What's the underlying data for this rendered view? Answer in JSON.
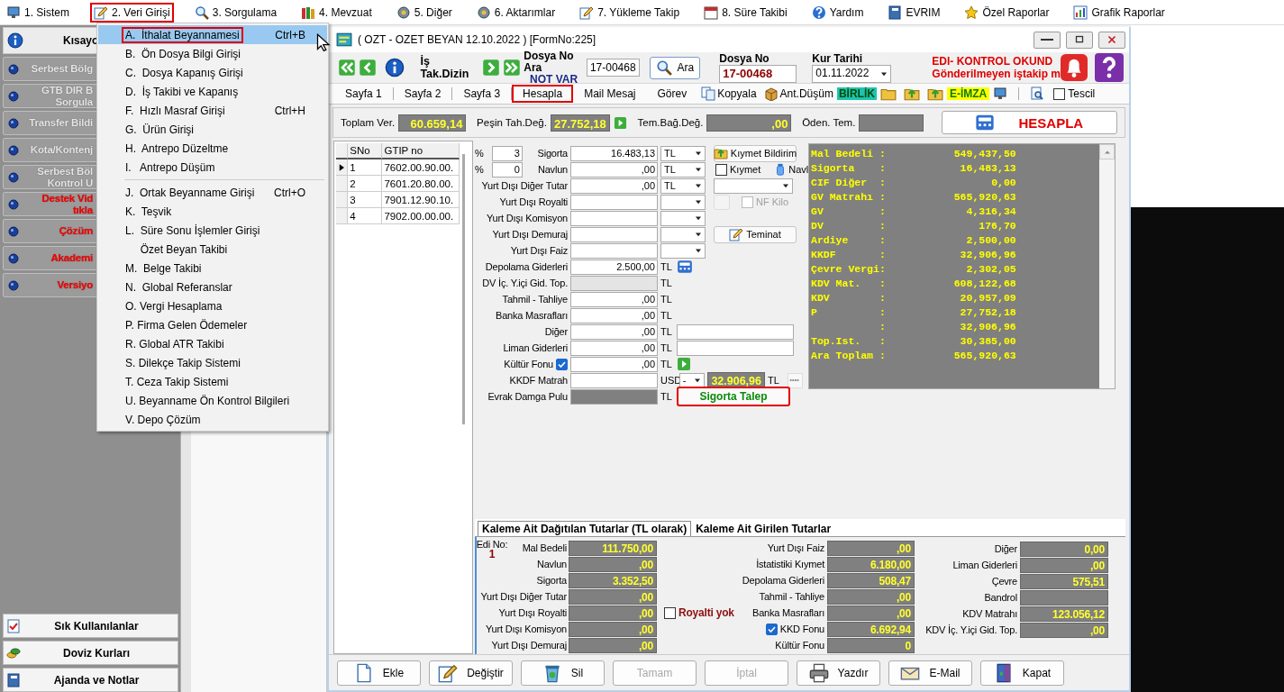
{
  "menu": [
    {
      "label": "1. Sistem",
      "selected": false
    },
    {
      "label": "2. Veri Girişi",
      "selected": true
    },
    {
      "label": "3. Sorgulama",
      "selected": false
    },
    {
      "label": "4. Mevzuat",
      "selected": false
    },
    {
      "label": "5. Diğer",
      "selected": false
    },
    {
      "label": "6. Aktarımlar",
      "selected": false
    },
    {
      "label": "7. Yükleme Takip",
      "selected": false
    },
    {
      "label": "8. Süre Takibi",
      "selected": false
    },
    {
      "label": "Yardım",
      "selected": false
    },
    {
      "label": "EVRIM",
      "selected": false
    },
    {
      "label": "Özel Raporlar",
      "selected": false
    },
    {
      "label": "Grafik Raporlar",
      "selected": false
    }
  ],
  "dropdown": {
    "groups": [
      [
        {
          "label": "A.  İthalat Beyannamesi",
          "shortcut": "Ctrl+B",
          "selected": true
        },
        {
          "label": "B.  Ön Dosya Bilgi Girişi",
          "selected": false
        },
        {
          "label": "C.  Dosya Kapanış Girişi",
          "selected": false
        },
        {
          "label": "D.  İş Takibi ve Kapanış",
          "selected": false
        },
        {
          "label": "F.  Hızlı Masraf Girişi",
          "shortcut": "Ctrl+H",
          "selected": false
        },
        {
          "label": "G.  Ürün Girişi",
          "selected": false
        },
        {
          "label": "H.  Antrepo Düzeltme",
          "selected": false
        },
        {
          "label": "I.   Antrepo Düşüm",
          "selected": false
        }
      ],
      [
        {
          "label": "J.  Ortak Beyanname Girişi",
          "shortcut": "Ctrl+O",
          "selected": false
        },
        {
          "label": "K.  Teşvik",
          "selected": false
        },
        {
          "label": "L.  Süre Sonu İşlemler Girişi",
          "selected": false
        },
        {
          "label": "     Özet Beyan Takibi",
          "selected": false
        },
        {
          "label": "M.  Belge Takibi",
          "selected": false
        },
        {
          "label": "N.  Global Referanslar",
          "selected": false
        },
        {
          "label": "O. Vergi Hesaplama",
          "selected": false
        },
        {
          "label": "P. Firma Gelen Ödemeler",
          "selected": false
        },
        {
          "label": "R. Global ATR Takibi",
          "selected": false
        },
        {
          "label": "S. Dilekçe Takip Sistemi",
          "selected": false
        },
        {
          "label": "T. Ceza Takip Sistemi",
          "selected": false
        },
        {
          "label": "U. Beyanname Ön Kontrol Bilgileri",
          "selected": false
        },
        {
          "label": "V. Depo Çözüm",
          "selected": false
        }
      ]
    ]
  },
  "sidebar": {
    "title": "Kısayo",
    "items": [
      {
        "lines": [
          "Serbest Bölg"
        ],
        "color": "#e6e6e6"
      },
      {
        "lines": [
          "GTB DIR B",
          "Sorgula"
        ],
        "color": "#e6e6e6"
      },
      {
        "lines": [
          "Transfer Bildi"
        ],
        "color": "#e6e6e6"
      },
      {
        "lines": [
          "Kota/Kontenj"
        ],
        "color": "#e6e6e6"
      },
      {
        "lines": [
          "Serbest Böl",
          "Kontrol U"
        ],
        "color": "#e6e6e6"
      },
      {
        "lines": [
          "Destek Vid",
          "tıkla"
        ],
        "color": "#ff0000"
      },
      {
        "lines": [
          "Çözüm"
        ],
        "color": "#ff0000"
      },
      {
        "lines": [
          "Akademi"
        ],
        "color": "#ff0000"
      },
      {
        "lines": [
          "Versiyo"
        ],
        "color": "#ff0000"
      }
    ],
    "bottom": [
      "Sık Kullanılanlar",
      "Doviz Kurları",
      "Ajanda ve Notlar"
    ]
  },
  "window": {
    "title": "( OZT - OZET BEYAN 12.10.2022 ) [FormNo:225]"
  },
  "toolbar": {
    "dizin_label": "İş Tak.Dizin",
    "search_label": "Dosya No Ara",
    "search_note": "NOT VAR",
    "search_value": "17-00468",
    "search_button": "Ara",
    "dosya_label": "Dosya No",
    "dosya_value": "17-00468",
    "kur_label": "Kur Tarihi",
    "kur_value": "01.11.2022",
    "alerts": [
      "EDI- KONTROL OKUND",
      "Gönderilmeyen iştakip m"
    ]
  },
  "tabs": [
    {
      "label": "Sayfa 1",
      "selected": false
    },
    {
      "label": "Sayfa 2",
      "selected": false
    },
    {
      "label": "Sayfa 3",
      "selected": false
    },
    {
      "label": "Hesapla",
      "selected": true
    },
    {
      "label": "Mail Mesaj",
      "selected": false
    },
    {
      "label": "Görev",
      "selected": false
    }
  ],
  "tools": {
    "copy": "Kopyala",
    "drop": "Ant.Düşüm",
    "birlik": "BİRLİK",
    "eimza": "E-İMZA",
    "tescil": {
      "label": "Tescil",
      "checked": false
    }
  },
  "totals": [
    {
      "label": "Toplam Ver.",
      "value": "60.659,14"
    },
    {
      "label": "Peşin Tah.Değ.",
      "value": "27.752,18"
    },
    {
      "label": "Tem.Bağ.Değ.",
      "value": ",00"
    },
    {
      "label": "Öden. Tem."
    }
  ],
  "hesapla_button": "HESAPLA",
  "items": {
    "columns": [
      "SNo",
      "GTIP no"
    ],
    "rows": [
      {
        "cells": [
          "1",
          "7602.00.90.00."
        ],
        "selected": true
      },
      {
        "cells": [
          "2",
          "7601.20.80.00."
        ],
        "selected": false
      },
      {
        "cells": [
          "3",
          "7901.12.90.10."
        ],
        "selected": false
      },
      {
        "cells": [
          "4",
          "7902.00.00.00."
        ],
        "selected": false
      }
    ]
  },
  "form": [
    {
      "kind": "pct",
      "pct_sign": "%",
      "pct": "3",
      "label": "Sigorta",
      "value": "16.483,13",
      "unit": "TL",
      "extras": [
        {
          "kind": "button",
          "label": "Kıymet Bildirim",
          "highlighted": false
        }
      ]
    },
    {
      "kind": "pct",
      "pct_sign": "%",
      "pct": "0",
      "label": "Navlun",
      "value": ",00",
      "unit": "TL",
      "extras": [
        {
          "kind": "check",
          "label": "Kıymet",
          "checked": false,
          "disabled": false
        },
        {
          "kind": "link",
          "label": "Navl"
        }
      ]
    },
    {
      "kind": "select",
      "label": "Yurt Dışı Diğer Tutar",
      "value": ",00",
      "unit": "TL",
      "extras": [
        {
          "kind": "select"
        }
      ]
    },
    {
      "kind": "select",
      "label": "Yurt Dışı Royalti",
      "extras": [
        {
          "kind": "blank"
        },
        {
          "kind": "check",
          "label": "NF Kilo",
          "checked": false,
          "disabled": true
        }
      ]
    },
    {
      "kind": "select",
      "label": "Yurt Dışı Komisyon"
    },
    {
      "kind": "select",
      "label": "Yurt Dışı Demuraj",
      "extras": [
        {
          "kind": "button",
          "label": "Teminat",
          "highlighted": false
        }
      ]
    },
    {
      "kind": "select",
      "label": "Yurt Dışı Faiz"
    },
    {
      "kind": "text",
      "label": "Depolama Giderleri",
      "value": "2.500,00",
      "unit": "TL",
      "extras": [
        {
          "kind": "calc"
        }
      ]
    },
    {
      "kind": "disabled",
      "label": "DV İç. Y.içi Gid. Top.",
      "unit": "TL"
    },
    {
      "kind": "text",
      "label": "Tahmil - Tahliye",
      "value": ",00",
      "unit": "TL"
    },
    {
      "kind": "text",
      "label": "Banka Masrafları",
      "value": ",00",
      "unit": "TL"
    },
    {
      "kind": "text",
      "label": "Diğer",
      "value": ",00",
      "unit": "TL",
      "extras": [
        {
          "kind": "field"
        }
      ]
    },
    {
      "kind": "text",
      "label": "Liman Giderleri",
      "value": ",00",
      "unit": "TL",
      "extras": [
        {
          "kind": "field"
        }
      ]
    },
    {
      "kind": "check",
      "label": "Kültür Fonu",
      "checked": true,
      "value": ",00",
      "unit": "TL",
      "extras": [
        {
          "kind": "go"
        }
      ]
    },
    {
      "kind": "text",
      "label": "KKDF Matrah",
      "unit": "USD",
      "extras": [
        {
          "kind": "select",
          "value": "-"
        },
        {
          "kind": "amount",
          "value": "32.906,96"
        },
        {
          "kind": "unit",
          "label": "TL"
        },
        {
          "kind": "dots"
        }
      ]
    },
    {
      "kind": "dark",
      "label": "Evrak Damga Pulu",
      "unit": "TL",
      "extras": [
        {
          "kind": "button",
          "label": "Sigorta Talep",
          "highlighted": true
        }
      ]
    }
  ],
  "summary": [
    {
      "label": "Mal Bedeli :",
      "value": "549,437,50"
    },
    {
      "label": "Sigorta    :",
      "value": "16,483,13"
    },
    {
      "label": "CIF Diğer  :",
      "value": "0,00"
    },
    {
      "label": "GV Matrahı :",
      "value": "565,920,63"
    },
    {
      "label": "GV         :",
      "value": "4,316,34"
    },
    {
      "label": "DV         :",
      "value": "176,70"
    },
    {
      "label": "Ardiye     :",
      "value": "2,500,00"
    },
    {
      "label": "KKDF       :",
      "value": "32,906,96"
    },
    {
      "label": "Çevre Vergi:",
      "value": "2,302,05"
    },
    {
      "label": "KDV Mat.   :",
      "value": "608,122,68"
    },
    {
      "label": "KDV        :",
      "value": "20,957,09"
    },
    {
      "label": "P          :",
      "value": "27,752,18"
    },
    {
      "label": "           :",
      "value": "32,906,96"
    },
    {
      "label": "Top.Ist.   :",
      "value": "30,385,00"
    },
    {
      "label": "Ara Toplam :",
      "value": "565,920,63"
    }
  ],
  "detail": {
    "tabs": [
      {
        "label": "Kaleme Ait Dağıtılan Tutarlar (TL olarak)",
        "selected": true
      },
      {
        "label": "Kaleme Ait Girilen Tutarlar",
        "selected": false
      }
    ],
    "edi_label": "Edi No:",
    "edi_value": "1",
    "royalti": {
      "label": "Royalti yok",
      "checked": false
    },
    "columns": [
      [
        {
          "label": "Mal Bedeli",
          "value": "111.750,00"
        },
        {
          "label": "Navlun",
          "value": ",00"
        },
        {
          "label": "Sigorta",
          "value": "3.352,50"
        },
        {
          "label": "Yurt Dışı Diğer Tutar",
          "value": ",00"
        },
        {
          "label": "Yurt Dışı Royalti",
          "value": ",00"
        },
        {
          "label": "Yurt Dışı Komisyon",
          "value": ",00"
        },
        {
          "label": "Yurt Dışı Demuraj",
          "value": ",00"
        }
      ],
      [
        {
          "label": "Yurt Dışı Faiz",
          "value": ",00"
        },
        {
          "label": "İstatistiki Kıymet",
          "value": "6.180,00"
        },
        {
          "label": "Depolama Giderleri",
          "value": "508,47"
        },
        {
          "label": "Tahmil - Tahliye",
          "value": ",00"
        },
        {
          "label": "Banka Masrafları",
          "value": ",00"
        },
        {
          "label": "KKD Fonu",
          "value": "6.692,94",
          "checked": true
        },
        {
          "label": "Kültür Fonu",
          "value": "0"
        }
      ],
      [
        {
          "label": "Diğer",
          "value": "0,00"
        },
        {
          "label": "Liman Giderleri",
          "value": ",00"
        },
        {
          "label": "Çevre",
          "value": "575,51"
        },
        {
          "label": "Bandrol"
        },
        {
          "label": "KDV Matrahı",
          "value": "123.056,12"
        },
        {
          "label": "KDV İç. Y.içi Gid. Top.",
          "value": ",00"
        }
      ]
    ]
  },
  "buttons": [
    {
      "label": "Ekle",
      "disabled": false
    },
    {
      "label": "Değiştir",
      "disabled": false
    },
    {
      "label": "Sil",
      "disabled": false
    },
    {
      "label": "Tamam",
      "disabled": true
    },
    {
      "label": "İptal",
      "disabled": true
    },
    {
      "label": "Yazdır",
      "disabled": false
    },
    {
      "label": "E-Mail",
      "disabled": false
    },
    {
      "label": "Kapat",
      "disabled": false
    }
  ]
}
